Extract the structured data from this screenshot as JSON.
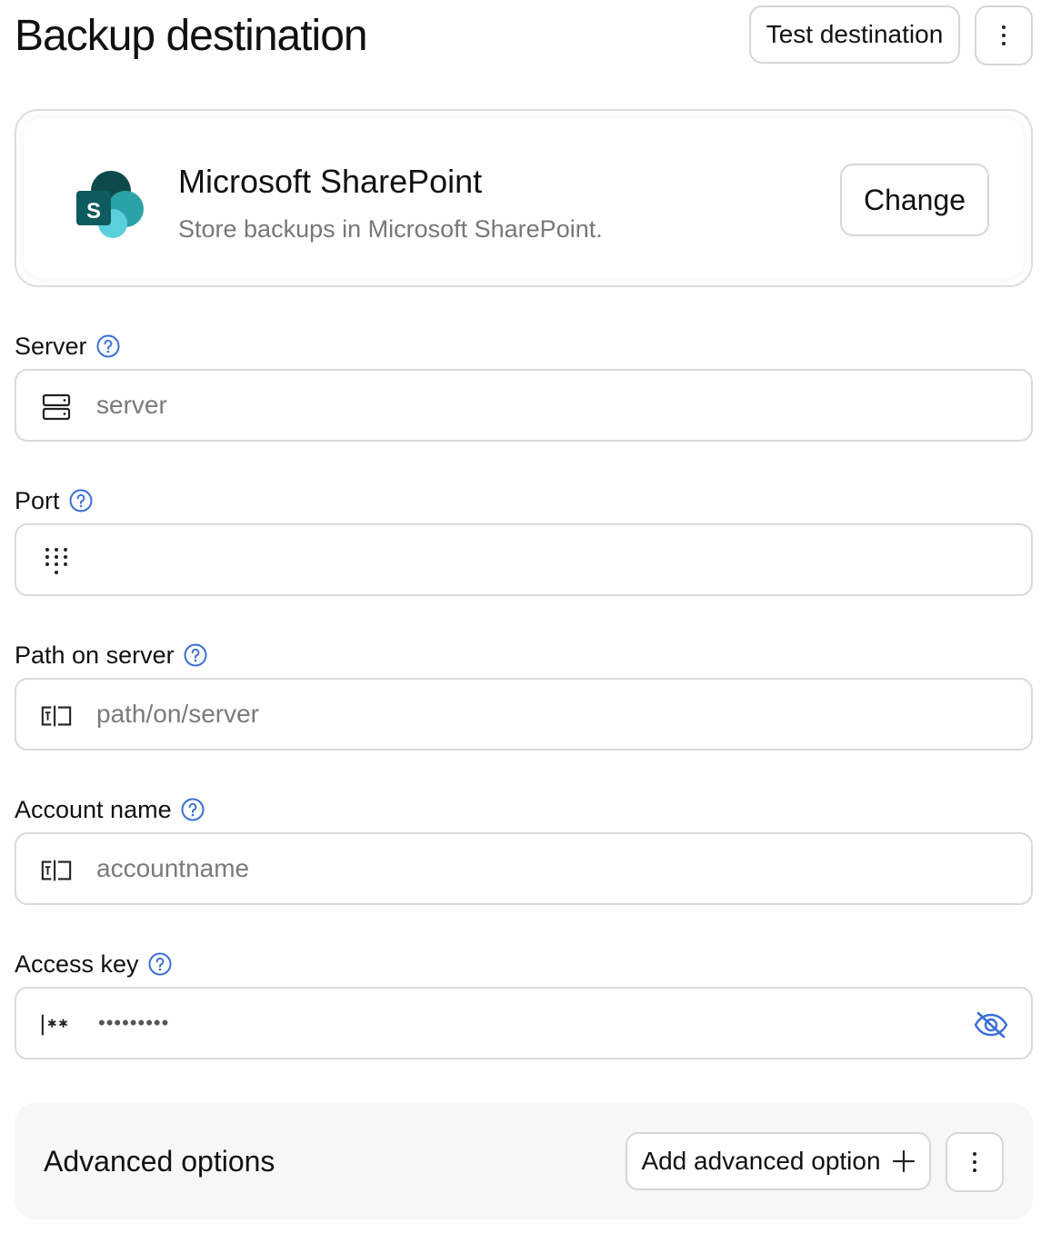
{
  "header": {
    "title": "Backup destination",
    "test_label": "Test destination"
  },
  "provider": {
    "name": "Microsoft SharePoint",
    "description": "Store backups in Microsoft SharePoint.",
    "change_label": "Change",
    "logo_letter": "S"
  },
  "fields": {
    "server": {
      "label": "Server",
      "placeholder": "server",
      "icon": "server-icon"
    },
    "port": {
      "label": "Port",
      "placeholder": "",
      "icon": "dialpad-icon"
    },
    "path": {
      "label": "Path on server",
      "placeholder": "path/on/server",
      "icon": "text-field-icon"
    },
    "account": {
      "label": "Account name",
      "placeholder": "accountname",
      "icon": "text-field-icon"
    },
    "access_key": {
      "label": "Access key",
      "value_mask": "•••••••••",
      "icon": "password-icon"
    }
  },
  "advanced": {
    "title": "Advanced options",
    "add_label": "Add advanced option"
  },
  "colors": {
    "accent": "#3b6fd8",
    "border": "#d9d9d9",
    "muted_text": "#777777",
    "panel_bg": "#f7f7f7"
  }
}
